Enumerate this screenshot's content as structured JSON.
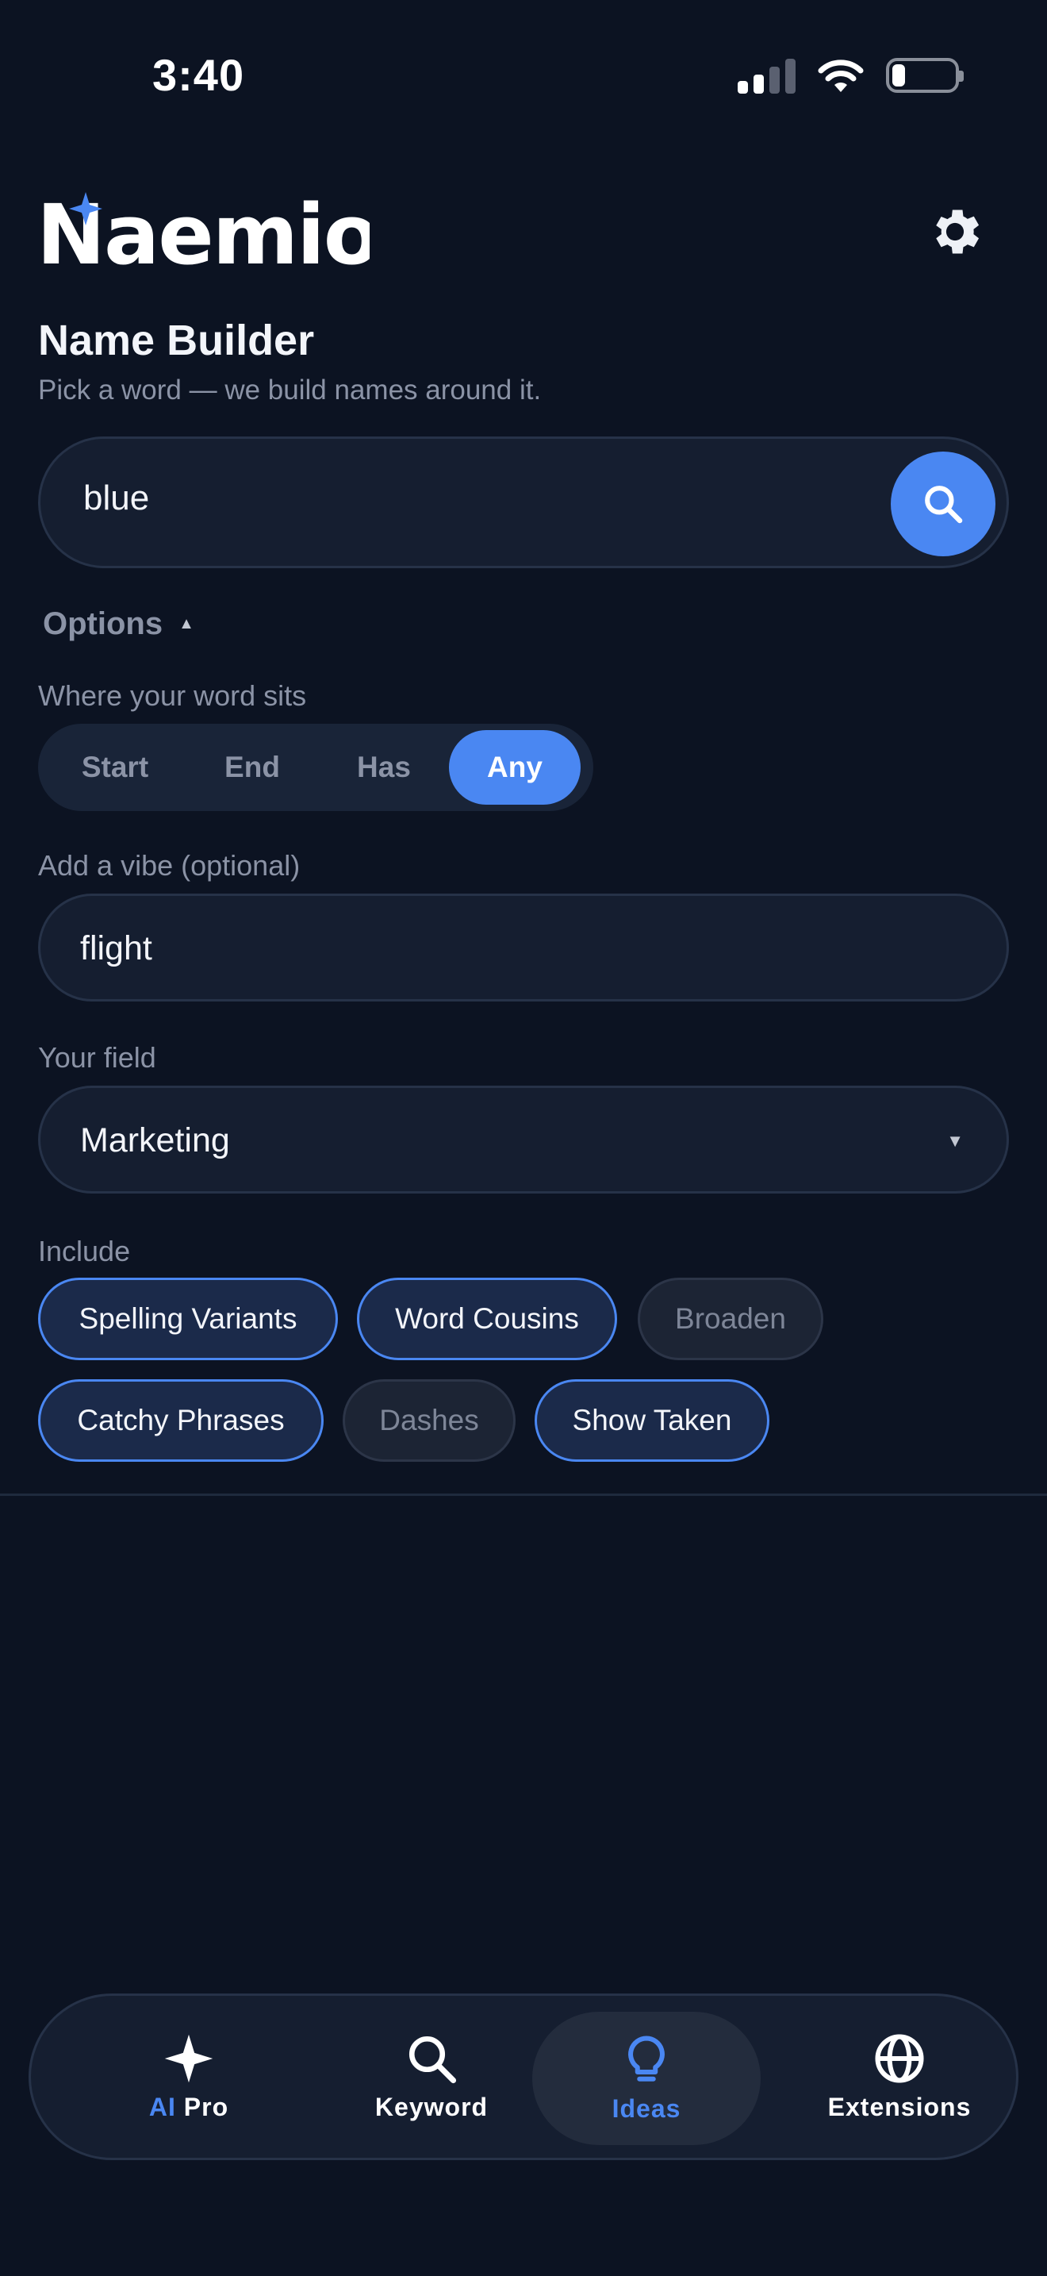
{
  "status_bar": {
    "time": "3:40"
  },
  "header": {
    "logo_text": "Naemio",
    "settings_icon": "gear-icon"
  },
  "page": {
    "title": "Name Builder",
    "subtitle": "Pick a word — we build names around it."
  },
  "search": {
    "value": "blue",
    "button_icon": "search-icon"
  },
  "options": {
    "toggle_label": "Options",
    "position_label": "Where your word sits",
    "positions": [
      "Start",
      "End",
      "Has",
      "Any"
    ],
    "selected_position": "Any",
    "vibe_label": "Add a vibe (optional)",
    "vibe_value": "flight",
    "field_label": "Your field",
    "field_value": "Marketing",
    "include_label": "Include",
    "include_chips": [
      {
        "label": "Spelling Variants",
        "selected": true
      },
      {
        "label": "Word Cousins",
        "selected": true
      },
      {
        "label": "Broaden",
        "selected": false
      },
      {
        "label": "Catchy Phrases",
        "selected": true
      },
      {
        "label": "Dashes",
        "selected": false
      },
      {
        "label": "Show Taken",
        "selected": true
      }
    ]
  },
  "bottom_nav": {
    "items": [
      {
        "label_accent": "AI",
        "label": "Pro",
        "icon": "sparkle-icon",
        "active": false
      },
      {
        "label": "Keyword",
        "icon": "search-icon",
        "active": false
      },
      {
        "label": "Ideas",
        "icon": "lightbulb-icon",
        "active": true
      },
      {
        "label": "Extensions",
        "icon": "globe-icon",
        "active": false
      }
    ]
  },
  "colors": {
    "background": "#0c1322",
    "accent": "#4a87f2",
    "surface": "#151e30",
    "muted_text": "#8b93a6"
  }
}
